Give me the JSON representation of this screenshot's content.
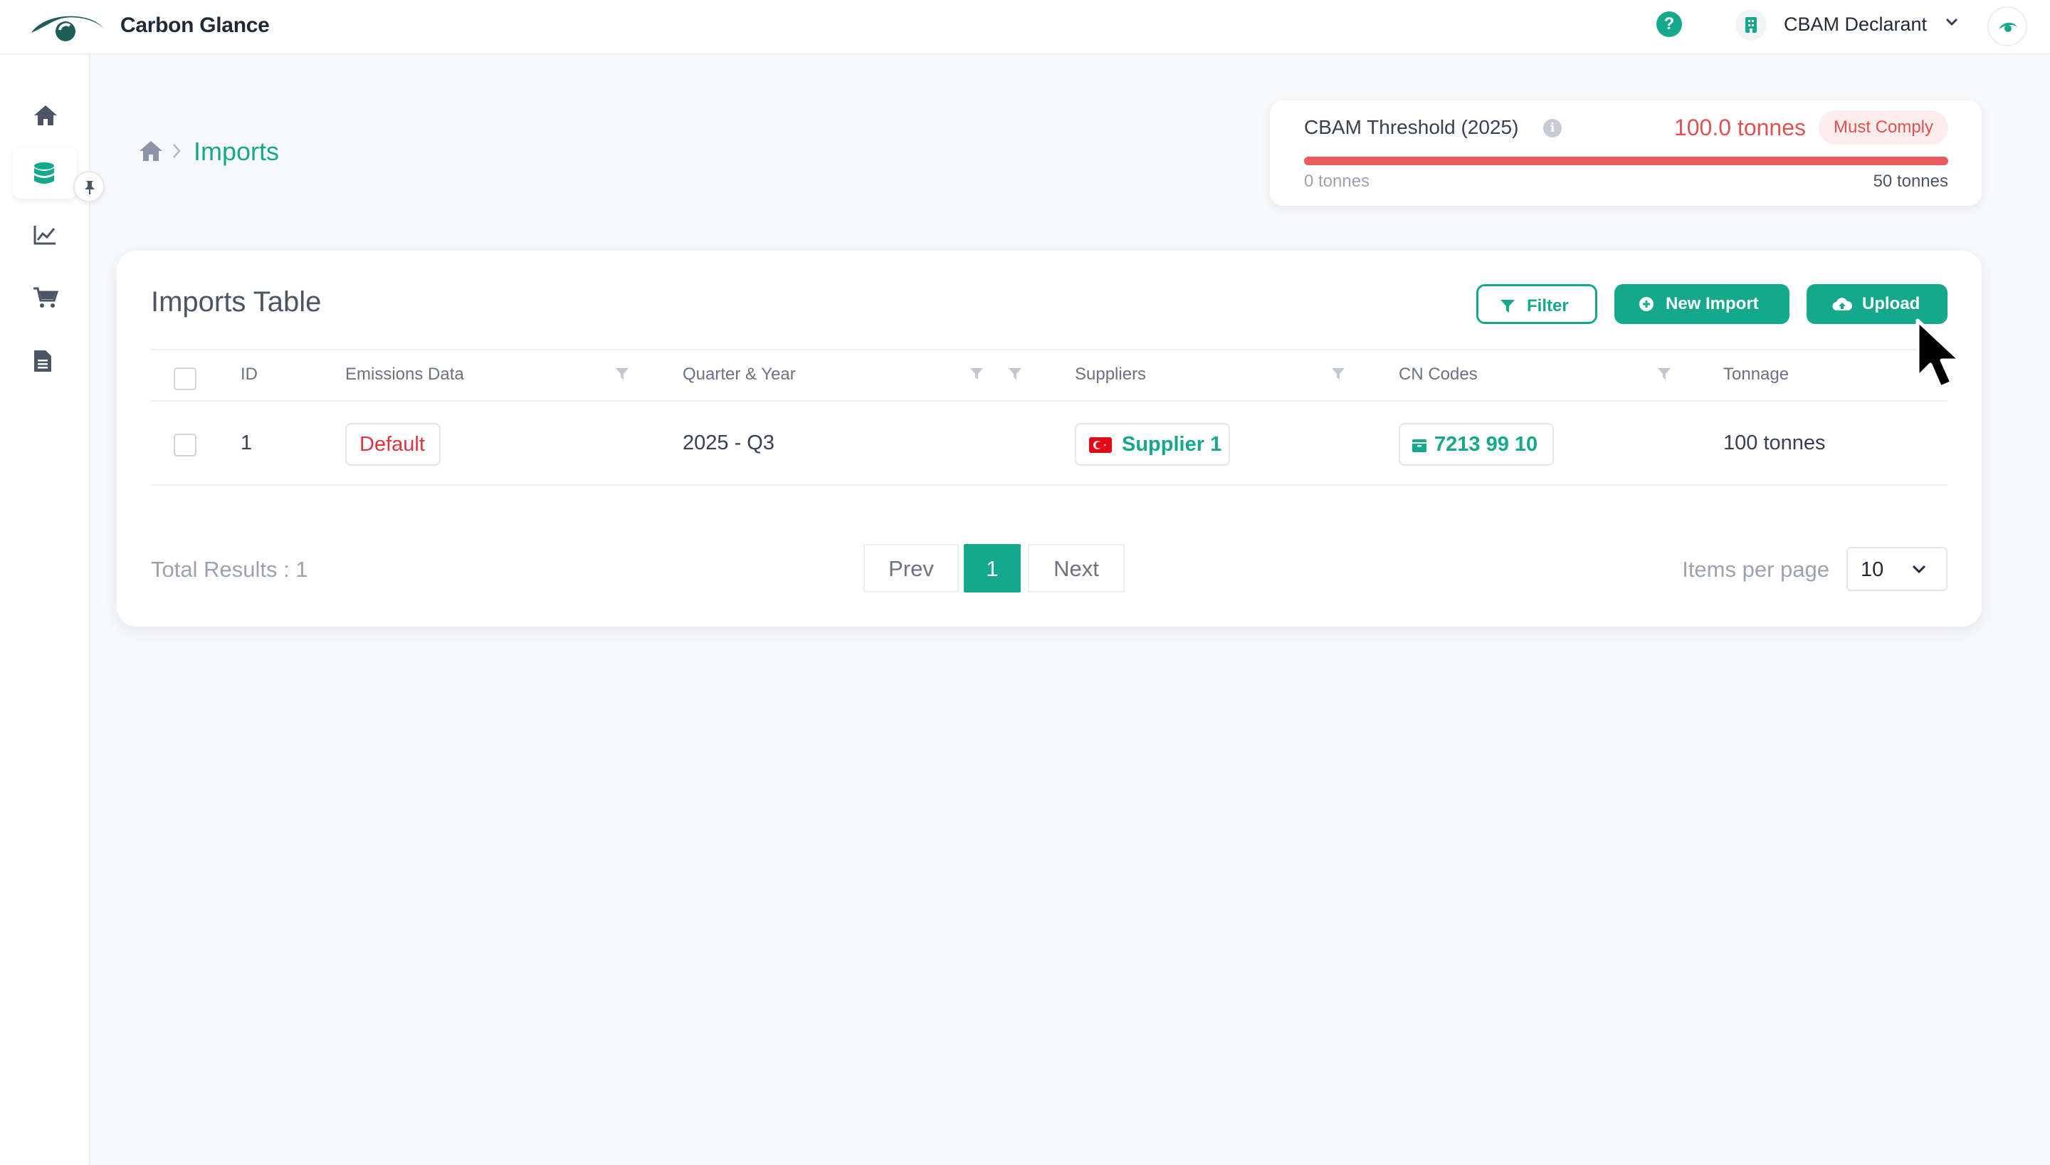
{
  "app": {
    "brand": "Carbon Glance"
  },
  "header": {
    "help_icon": "question-circle-icon",
    "user_name": "CBAM Declarant",
    "accent": "#15a88a"
  },
  "sidebar": {
    "items": [
      {
        "icon": "home-icon",
        "active": false
      },
      {
        "icon": "database-icon",
        "active": true
      },
      {
        "icon": "chart-line-icon",
        "active": false
      },
      {
        "icon": "cart-icon",
        "active": false
      },
      {
        "icon": "document-icon",
        "active": false
      }
    ]
  },
  "breadcrumb": {
    "current": "Imports"
  },
  "threshold": {
    "title": "CBAM Threshold (2025)",
    "value": "100.0 tonnes",
    "badge": "Must Comply",
    "min_label": "0 tonnes",
    "max_label": "50 tonnes",
    "progress": 1.0,
    "status_color": "#e05252"
  },
  "table": {
    "title": "Imports Table",
    "buttons": {
      "filter": "Filter",
      "new_import": "New Import",
      "upload": "Upload"
    },
    "columns": [
      "ID",
      "Emissions Data",
      "Quarter & Year",
      "Suppliers",
      "CN Codes",
      "Tonnage"
    ],
    "rows": [
      {
        "id": "1",
        "emissions": "Default",
        "quarter": "2025 - Q3",
        "supplier": "Supplier 1",
        "cn_code": "7213 99 10",
        "tonnage": "100 tonnes"
      }
    ],
    "total": "Total Results : 1",
    "pagination": {
      "prev": "Prev",
      "page": "1",
      "next": "Next"
    },
    "items_per_page_label": "Items per page",
    "items_per_page": "10"
  }
}
